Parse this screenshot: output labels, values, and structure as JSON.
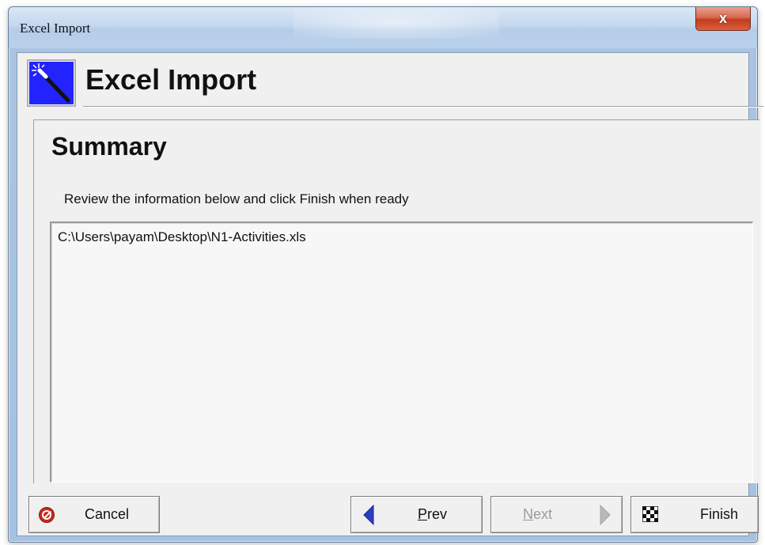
{
  "window": {
    "title": "Excel Import",
    "close_label": "x"
  },
  "header": {
    "title": "Excel Import",
    "icon": "magic-wand-icon"
  },
  "page": {
    "heading": "Summary",
    "instructions": "Review the information below and click Finish when ready",
    "summary_text": "C:\\Users\\payam\\Desktop\\N1-Activities.xls"
  },
  "buttons": {
    "cancel": {
      "label": "Cancel",
      "icon": "stop-icon"
    },
    "prev": {
      "label_underlined": "P",
      "label_rest": "rev",
      "icon": "arrow-left-icon"
    },
    "next": {
      "label_underlined": "N",
      "label_rest": "ext",
      "icon": "arrow-right-icon",
      "enabled": false
    },
    "finish": {
      "label": "Finish",
      "icon": "checkered-flag-icon"
    }
  },
  "colors": {
    "wizard_icon_bg": "#2323ff",
    "arrow_active": "#2a3ec7",
    "arrow_disabled": "#b9b9b9",
    "stop_red": "#c8281e"
  }
}
